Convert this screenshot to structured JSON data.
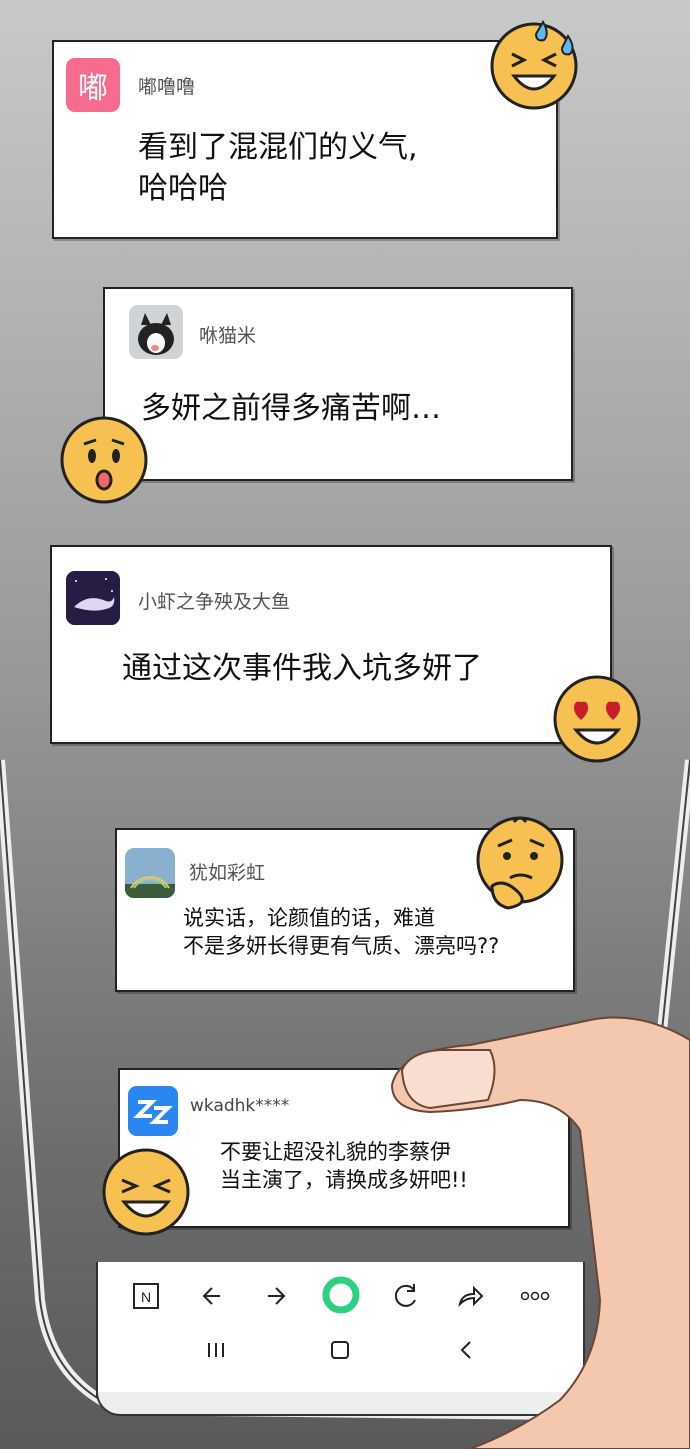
{
  "comments": [
    {
      "username": "嘟噜噜",
      "avatar_text": "嘟",
      "avatar_color": "#f56c8f",
      "text_lines": [
        "看到了混混们的义气,",
        "哈哈哈"
      ]
    },
    {
      "username": "咻猫米",
      "avatar_icon": "cat-photo",
      "text_lines": [
        "多妍之前得多痛苦啊…"
      ]
    },
    {
      "username": "小虾之争殃及大鱼",
      "avatar_icon": "whale-photo",
      "text_lines": [
        "通过这次事件我入坑多妍了"
      ]
    },
    {
      "username": "犹如彩虹",
      "avatar_icon": "rainbow-photo",
      "text_lines": [
        "说实话，论颜值的话，难道",
        "不是多妍长得更有气质、漂亮吗??"
      ]
    },
    {
      "username": "wkadhk****",
      "avatar_icon": "zzz-icon",
      "avatar_color": "#2a86f0",
      "text_lines": [
        "不要让超没礼貌的李蔡伊",
        "当主演了，请换成多妍吧!!"
      ]
    }
  ],
  "emojis": [
    "laughing-sweat-emoji",
    "worried-emoji",
    "heart-eyes-emoji",
    "thinking-emoji",
    "laughing-emoji"
  ],
  "browser_bar": {
    "icons": [
      "n-icon",
      "back-arrow-icon",
      "forward-arrow-icon",
      "home-circle-icon",
      "refresh-icon",
      "share-icon",
      "more-icon"
    ],
    "system_icons": [
      "recent-apps-icon",
      "home-icon",
      "back-icon"
    ],
    "accent": "#2bd17e"
  }
}
